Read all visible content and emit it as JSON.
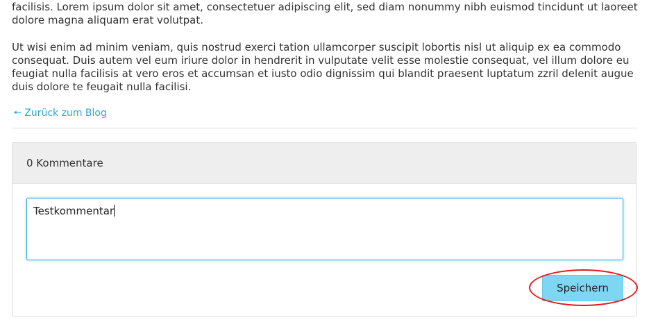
{
  "article": {
    "paragraph_1": "Duis autem vel eum iriure dolor in hendrerit in vulputate velit esse molestie consequat, vel illum dolore eu feugiat nulla facilisis. Lorem ipsum dolor sit amet, consectetuer adipiscing elit, sed diam nonummy nibh euismod tincidunt ut laoreet dolore magna aliquam erat volutpat.",
    "paragraph_2": "Ut wisi enim ad minim veniam, quis nostrud exerci tation ullamcorper suscipit lobortis nisl ut aliquip ex ea commodo consequat. Duis autem vel eum iriure dolor in hendrerit in vulputate velit esse molestie consequat, vel illum dolore eu feugiat nulla facilisis at vero eros et accumsan et iusto odio dignissim qui blandit praesent luptatum zzril delenit augue duis dolore te feugait nulla facilisi."
  },
  "back_link": {
    "icon": "arrow-left-icon",
    "label": "Zurück zum Blog"
  },
  "comments": {
    "header": "0 Kommentare",
    "input_value": "Testkommentar",
    "save_label": "Speichern"
  },
  "colors": {
    "link": "#2aa7d3",
    "button": "#7dd6f2",
    "input_focus": "#36a8d6",
    "highlight": "#e01b1b"
  }
}
